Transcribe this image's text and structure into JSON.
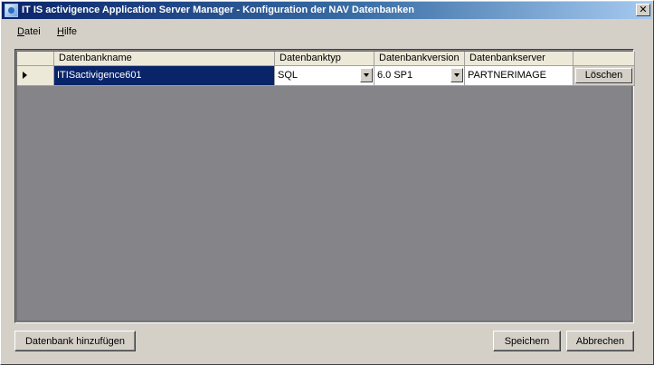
{
  "window": {
    "title": "IT IS activigence Application Server Manager - Konfiguration der NAV Datenbanken",
    "close_glyph": "✕"
  },
  "menu": {
    "items": [
      {
        "label": "Datei",
        "accel": "D"
      },
      {
        "label": "Hilfe",
        "accel": "H"
      }
    ]
  },
  "grid": {
    "columns": [
      "Datenbankname",
      "Datenbanktyp",
      "Datenbankversion",
      "Datenbankserver"
    ],
    "rows": [
      {
        "name": "ITISactivigence601",
        "type": "SQL",
        "version": "6.0 SP1",
        "server": "PARTNERIMAGE",
        "delete_label": "Löschen",
        "selected": true
      }
    ]
  },
  "buttons": {
    "add_db": "Datenbank hinzufügen",
    "save": "Speichern",
    "cancel": "Abbrechen"
  },
  "colors": {
    "title_active": "#0a246a",
    "selection": "#0a246a",
    "grid_background": "#858489",
    "face": "#d4d0c8"
  }
}
